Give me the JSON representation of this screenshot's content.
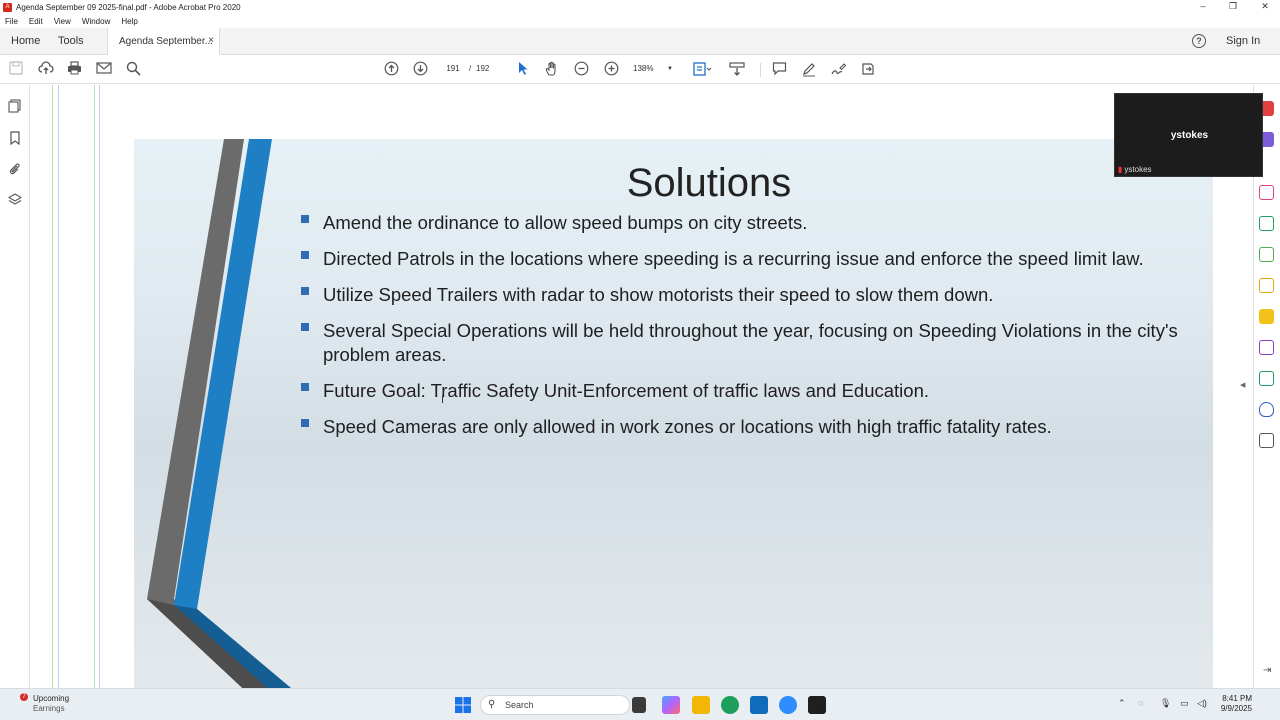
{
  "window": {
    "title": "Agenda September 09 2025-final.pdf - Adobe Acrobat Pro 2020"
  },
  "menu": [
    "File",
    "Edit",
    "View",
    "Window",
    "Help"
  ],
  "tabs": {
    "home": "Home",
    "tools": "Tools",
    "document": "Agenda September...",
    "close_glyph": "×",
    "sign_in": "Sign In",
    "help_glyph": "?"
  },
  "toolbar": {
    "current_page": "191",
    "page_separator": "/",
    "total_pages": "192",
    "zoom": "138%"
  },
  "slide": {
    "title": "Solutions",
    "bullets": [
      "Amend the ordinance to allow speed bumps on city streets.",
      "Directed Patrols in the locations where speeding is a recurring issue and enforce the speed limit law.",
      " Several Special Operations will be held throughout the year, focusing on Speeding Violations in the city's problem areas.",
      "Future Goal: Traffic Safety Unit-Enforcement of traffic laws and Education.",
      "Speed Cameras are only allowed in work zones or locations with high traffic fatality rates."
    ],
    "bullet_utilize": "Utilize Speed Trailers with radar to show motorists their speed to slow them down.",
    "accent_blue": "#1e7fc4",
    "accent_gray": "#6b6b6b"
  },
  "zoom_tile": {
    "display_name": "ystokes",
    "tag_name": "ystokes"
  },
  "taskbar": {
    "weather_title": "Upcoming",
    "weather_sub": "Earnings",
    "weather_badge": "7",
    "search_label": "Search",
    "time": "8:41 PM",
    "date": "9/9/2025"
  }
}
